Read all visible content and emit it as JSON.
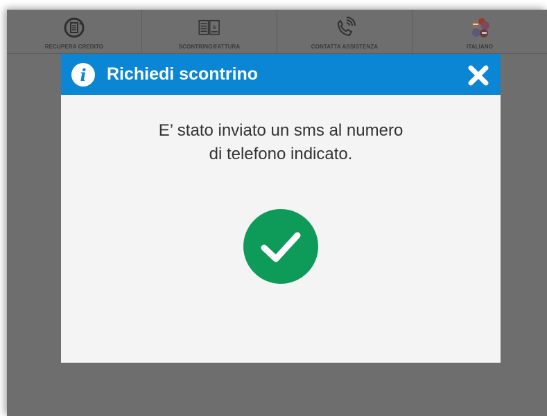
{
  "topbar": {
    "items": [
      {
        "label": "RECUPERA CREDITO",
        "icon": "recover-credit-icon"
      },
      {
        "label": "SCONTRINO/FATTURA",
        "icon": "receipt-invoice-icon"
      },
      {
        "label": "CONTATTA ASSISTENZA",
        "icon": "phone-support-icon"
      },
      {
        "label": "ITALIANO",
        "icon": "language-flags-icon"
      }
    ]
  },
  "modal": {
    "title": "Richiedi scontrino",
    "message_line1": "E’ stato inviato un sms al numero",
    "message_line2": "di telefono indicato.",
    "header_color": "#0a86d4",
    "success_color": "#0e9a58"
  }
}
